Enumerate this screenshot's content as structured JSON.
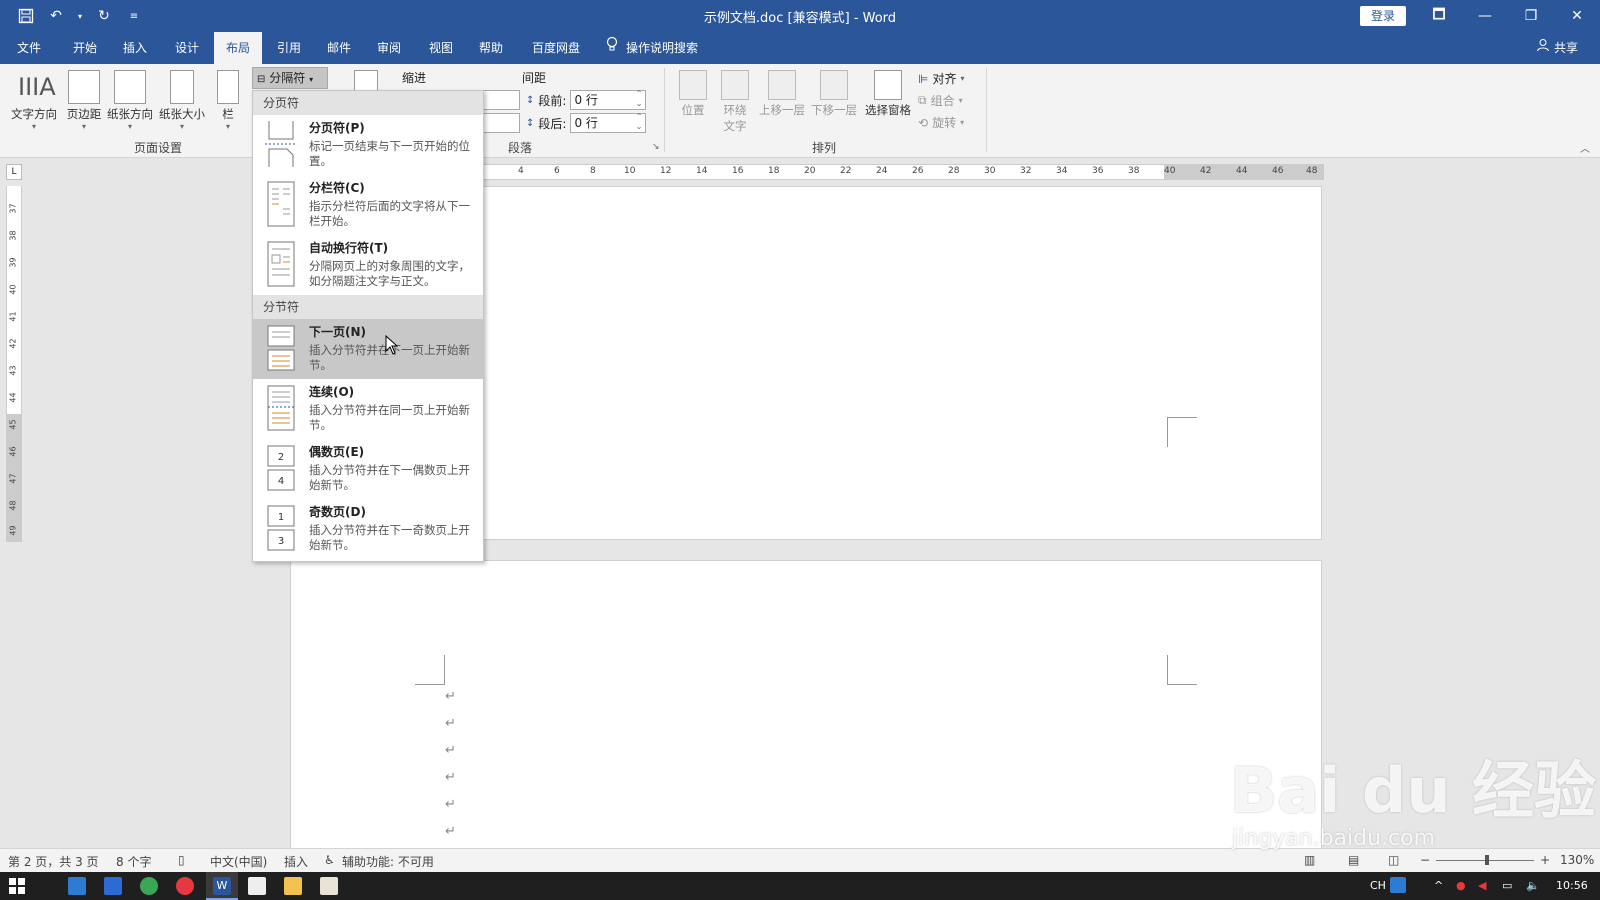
{
  "window": {
    "title": "示例文档.doc [兼容模式] - Word",
    "login_label": "登录",
    "controls": [
      "🗖",
      "—",
      "❐",
      "✕"
    ]
  },
  "tabs": [
    "文件",
    "开始",
    "插入",
    "设计",
    "布局",
    "引用",
    "邮件",
    "审阅",
    "视图",
    "帮助",
    "百度网盘"
  ],
  "tell_me": "操作说明搜索",
  "share": "共享",
  "ribbon": {
    "page_setup": {
      "text_direction": "文字方向",
      "margins": "页边距",
      "orientation": "纸张方向",
      "size": "纸张大小",
      "columns": "栏",
      "breaks": "分隔符",
      "group_label": "页面设置"
    },
    "paragraph": {
      "indent_label": "缩进",
      "spacing_label": "间距",
      "before_label": "段前:",
      "before_value": "0 行",
      "after_label": "段后:",
      "after_value": "0 行",
      "group_label": "段落"
    },
    "arrange": {
      "position": "位置",
      "wrap_text": "环绕文字",
      "bring_forward": "上移一层",
      "send_backward": "下移一层",
      "selection_pane": "选择窗格",
      "align": "对齐",
      "group": "组合",
      "rotate": "旋转",
      "group_label": "排列"
    }
  },
  "ruler": {
    "h_ticks": [
      "4",
      "6",
      "8",
      "10",
      "12",
      "14",
      "16",
      "18",
      "20",
      "22",
      "24",
      "26",
      "28",
      "30",
      "32",
      "34",
      "36",
      "38",
      "40",
      "42",
      "44",
      "46",
      "48"
    ],
    "v_ticks": [
      "37",
      "38",
      "39",
      "40",
      "41",
      "42",
      "43",
      "44",
      "45",
      "46",
      "47",
      "48",
      "49"
    ]
  },
  "dropdown": {
    "section1": "分页符",
    "section2": "分节符",
    "items1": [
      {
        "title": "分页符(P)",
        "desc": "标记一页结束与下一页开始的位置。"
      },
      {
        "title": "分栏符(C)",
        "desc": "指示分栏符后面的文字将从下一栏开始。"
      },
      {
        "title": "自动换行符(T)",
        "desc": "分隔网页上的对象周围的文字，如分隔题注文字与正文。"
      }
    ],
    "items2": [
      {
        "title": "下一页(N)",
        "desc": "插入分节符并在下一页上开始新节。"
      },
      {
        "title": "连续(O)",
        "desc": "插入分节符并在同一页上开始新节。"
      },
      {
        "title": "偶数页(E)",
        "desc": "插入分节符并在下一偶数页上开始新节。"
      },
      {
        "title": "奇数页(D)",
        "desc": "插入分节符并在下一奇数页上开始新节。"
      }
    ]
  },
  "document": {
    "paragraph_mark": "↵"
  },
  "status": {
    "page": "第 2 页，共 3 页",
    "words": "8 个字",
    "language": "中文(中国)",
    "mode": "插入",
    "accessibility": "辅助功能: 不可用",
    "zoom": "130%",
    "zoom_level": 0.5
  },
  "taskbar": {
    "ime": "CH",
    "time": "10:56"
  },
  "watermark": {
    "brand": "Bai du 经验",
    "url": "jingyan.baidu.com"
  }
}
